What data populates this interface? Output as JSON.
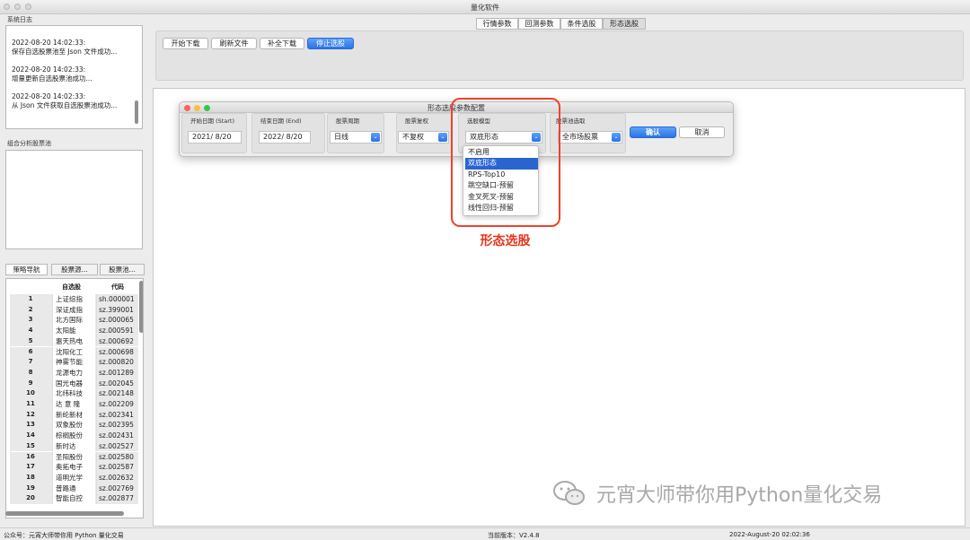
{
  "window": {
    "title": "量化软件"
  },
  "system_log": {
    "label": "系统日志",
    "entries": [
      {
        "time": "2022-08-20 14:02:33:",
        "message": "保存自选股票池至 Json 文件成功..."
      },
      {
        "time": "2022-08-20 14:02:33:",
        "message": "增量更新自选股票池成功..."
      },
      {
        "time": "2022-08-20 14:02:33:",
        "message": "从 Json 文件获取自选股票池成功..."
      }
    ]
  },
  "group_pool": {
    "label": "组合分析股票池"
  },
  "side_tabs": [
    "策略导航",
    "股票源...",
    "股票池..."
  ],
  "stock_table": {
    "headers": [
      "自选股",
      "代码"
    ],
    "rows": [
      [
        "1",
        "上证综指",
        "sh.000001"
      ],
      [
        "2",
        "深证成指",
        "sz.399001"
      ],
      [
        "3",
        "北方国际",
        "sz.000065"
      ],
      [
        "4",
        "太阳能",
        "sz.000591"
      ],
      [
        "5",
        "惠天热电",
        "sz.000692"
      ],
      [
        "6",
        "沈阳化工",
        "sz.000698"
      ],
      [
        "7",
        "神雾节能",
        "sz.000820"
      ],
      [
        "8",
        "龙源电力",
        "sz.001289"
      ],
      [
        "9",
        "国光电器",
        "sz.002045"
      ],
      [
        "10",
        "北纬科技",
        "sz.002148"
      ],
      [
        "11",
        "达 意 隆",
        "sz.002209"
      ],
      [
        "12",
        "新纶新材",
        "sz.002341"
      ],
      [
        "13",
        "双象股份",
        "sz.002395"
      ],
      [
        "14",
        "棕榈股份",
        "sz.002431"
      ],
      [
        "15",
        "新时达",
        "sz.002527"
      ],
      [
        "16",
        "圣阳股份",
        "sz.002580"
      ],
      [
        "17",
        "奥拓电子",
        "sz.002587"
      ],
      [
        "18",
        "道明光学",
        "sz.002632"
      ],
      [
        "19",
        "普路通",
        "sz.002769"
      ],
      [
        "20",
        "智能自控",
        "sz.002877"
      ]
    ]
  },
  "param_tabs": [
    "行情参数",
    "回测参数",
    "条件选股",
    "形态选股"
  ],
  "toolbar": {
    "buttons": [
      "开始下载",
      "刷新文件",
      "补全下载",
      "停止选股"
    ]
  },
  "dialog": {
    "title": "形态选股参数配置",
    "start_date": {
      "label": "开始日期 (Start)",
      "value": "2021/  8/20"
    },
    "end_date": {
      "label": "结束日期 (End)",
      "value": "2022/  8/20"
    },
    "period": {
      "label": "股票周期",
      "value": "日线"
    },
    "adjust": {
      "label": "股票复权",
      "value": "不复权"
    },
    "model": {
      "label": "选股模型",
      "value": "双底形态",
      "options": [
        "不启用",
        "双底形态",
        "RPS-Top10",
        "跳空缺口-预留",
        "金叉死叉-预留",
        "线性回归-预留"
      ]
    },
    "pool": {
      "label": "股票池选取",
      "value": "全市场股票"
    },
    "confirm": "确认",
    "cancel": "取消"
  },
  "annotation": "形态选股",
  "watermark": "元宵大师带你用Python量化交易",
  "status": {
    "left": "公众号：元宵大师带你用 Python 量化交易",
    "version": "当前版本：V2.4.8",
    "datetime": "2022-August-20 02:02:36"
  },
  "colors": {
    "accent": "#2a73e6",
    "annotation": "#e8341c",
    "watermark": "#a8a8a8"
  }
}
